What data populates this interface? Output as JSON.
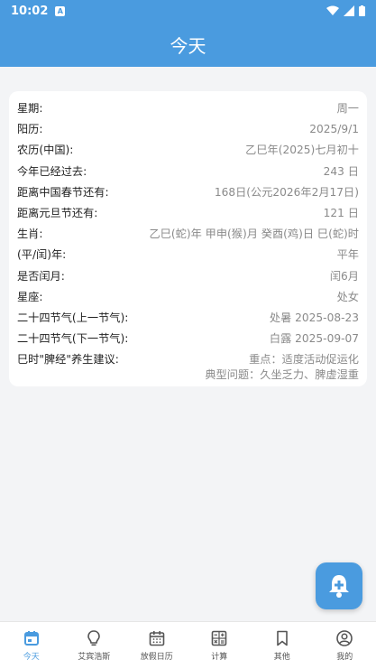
{
  "status": {
    "time": "10:02",
    "notif_glyph": "A"
  },
  "header": {
    "title": "今天"
  },
  "rows": [
    {
      "label": "星期:",
      "value": "周一"
    },
    {
      "label": "阳历:",
      "value": "2025/9/1"
    },
    {
      "label": "农历(中国):",
      "value": "乙巳年(2025)七月初十"
    },
    {
      "label": "今年已经过去:",
      "value": "243 日"
    },
    {
      "label": "距离中国春节还有:",
      "value": "168日(公元2026年2月17日)"
    },
    {
      "label": "距离元旦节还有:",
      "value": "121 日"
    },
    {
      "label": "生肖:",
      "value": "乙巳(蛇)年 甲申(猴)月 癸酉(鸡)日 巳(蛇)时"
    },
    {
      "label": "(平/闰)年:",
      "value": "平年"
    },
    {
      "label": "是否闰月:",
      "value": "闰6月"
    },
    {
      "label": "星座:",
      "value": "处女"
    },
    {
      "label": "二十四节气(上一节气):",
      "value": "处暑 2025-08-23"
    },
    {
      "label": "二十四节气(下一节气):",
      "value": "白露 2025-09-07"
    }
  ],
  "advice": {
    "label": "巳时\"脾经\"养生建议:",
    "line1": "重点：适度活动促运化",
    "line2": "典型问题：久坐乏力、脾虚湿重"
  },
  "nav": [
    {
      "label": "今天"
    },
    {
      "label": "艾宾浩斯"
    },
    {
      "label": "放假日历"
    },
    {
      "label": "计算"
    },
    {
      "label": "其他"
    },
    {
      "label": "我的"
    }
  ],
  "colors": {
    "primary": "#4a9bdf",
    "value_text": "#8a8a8a"
  }
}
